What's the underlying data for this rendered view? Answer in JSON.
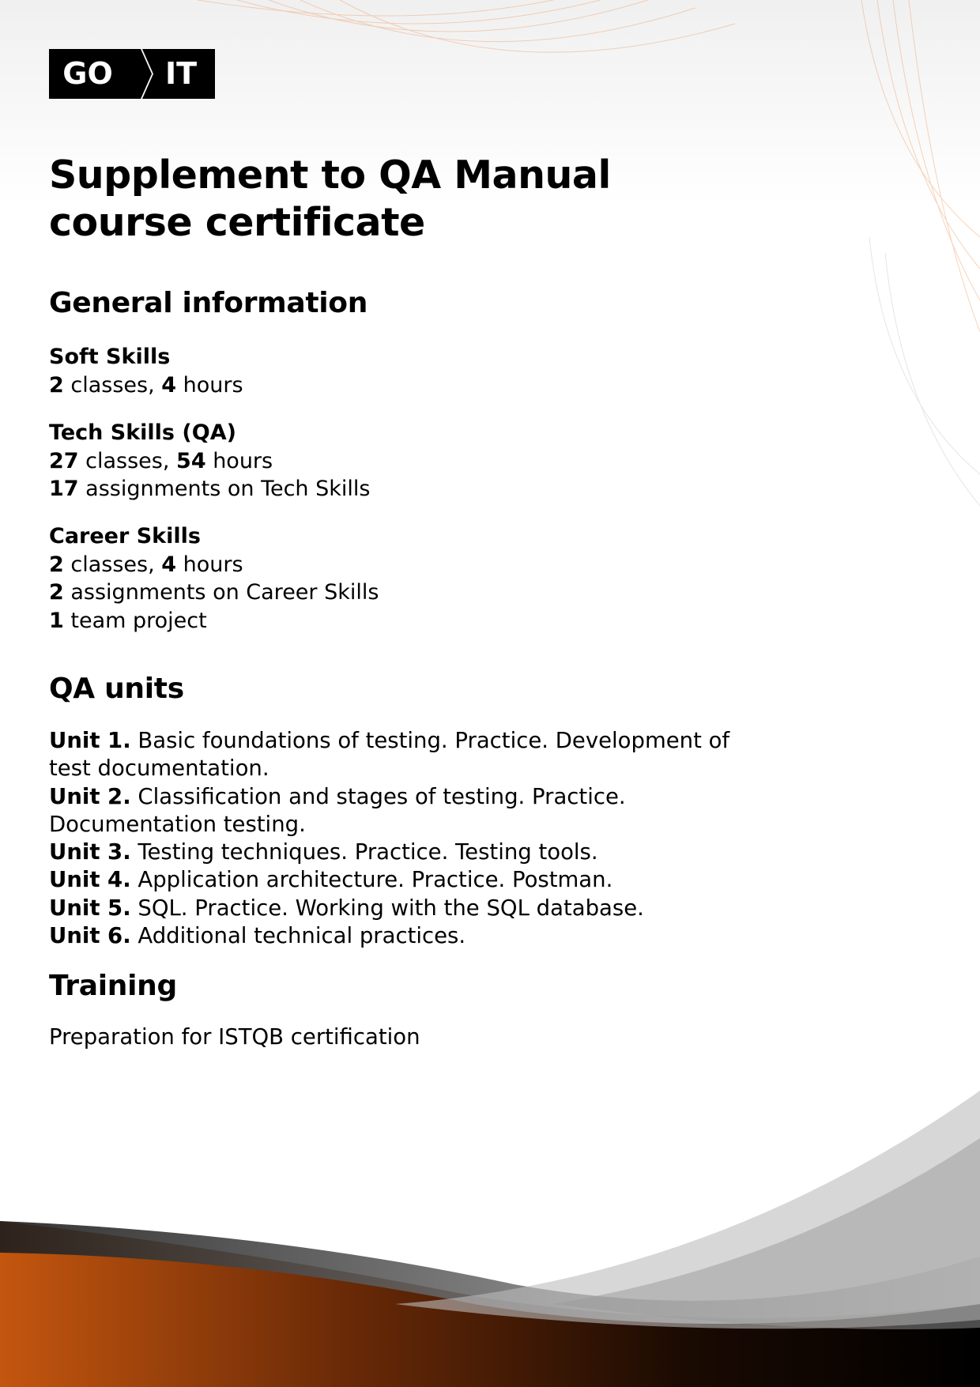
{
  "logo": {
    "left": "GO",
    "right": "IT"
  },
  "title": {
    "line1": "Supplement to QA Manual",
    "line2": "course certificate"
  },
  "general": {
    "heading": "General information",
    "soft": {
      "name": "Soft Skills",
      "classes": "2",
      "classes_label": " classes, ",
      "hours": "4",
      "hours_label": " hours"
    },
    "tech": {
      "name": "Tech Skills (QA)",
      "classes": "27",
      "classes_label": " classes, ",
      "hours": "54",
      "hours_label": " hours",
      "assignments": "17",
      "assignments_label": " assignments on Tech Skills"
    },
    "career": {
      "name": "Career Skills",
      "classes": "2",
      "classes_label": " classes, ",
      "hours": "4",
      "hours_label": " hours",
      "assignments": "2",
      "assignments_label": " assignments on Career Skills",
      "projects": "1",
      "projects_label": " team project"
    }
  },
  "units": {
    "heading": "QA units",
    "items": [
      {
        "label": "Unit 1.",
        "text": " Basic foundations of testing. Practice. Development of test documentation."
      },
      {
        "label": "Unit 2.",
        "text": " Classification and stages of testing. Practice. Documentation testing."
      },
      {
        "label": "Unit 3.",
        "text": " Testing techniques. Practice. Testing tools."
      },
      {
        "label": "Unit 4.",
        "text": " Application architecture. Practice. Postman."
      },
      {
        "label": "Unit 5.",
        "text": " SQL. Practice. Working with the SQL database."
      },
      {
        "label": "Unit 6.",
        "text": " Additional technical practices."
      }
    ]
  },
  "training": {
    "heading": "Training",
    "text": "Preparation for ISTQB certification"
  },
  "colors": {
    "accent": "#e0661c",
    "dark": "#000000",
    "text": "#000000"
  }
}
